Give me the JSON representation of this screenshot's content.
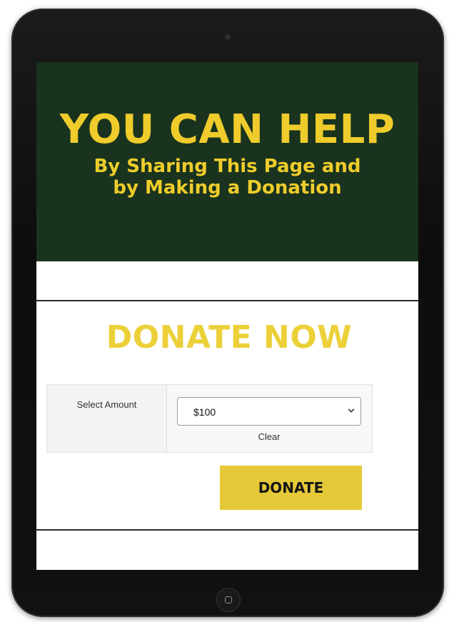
{
  "hero": {
    "title": "YOU CAN HELP",
    "subtitle_line1": "By Sharing This Page and",
    "subtitle_line2": "by Making a Donation"
  },
  "donate": {
    "heading": "DONATE NOW",
    "amount_label": "Select Amount",
    "selected_amount": "$100",
    "clear_label": "Clear",
    "button_label": "DONATE"
  },
  "colors": {
    "hero_background": "#19331e",
    "accent_yellow": "#efcc2b",
    "button_yellow": "#e6c938",
    "tablet_frame": "#111111"
  },
  "icons": {
    "select_chevron": "chevron-down-icon",
    "home_button": "home-button-icon",
    "camera": "camera-icon"
  }
}
